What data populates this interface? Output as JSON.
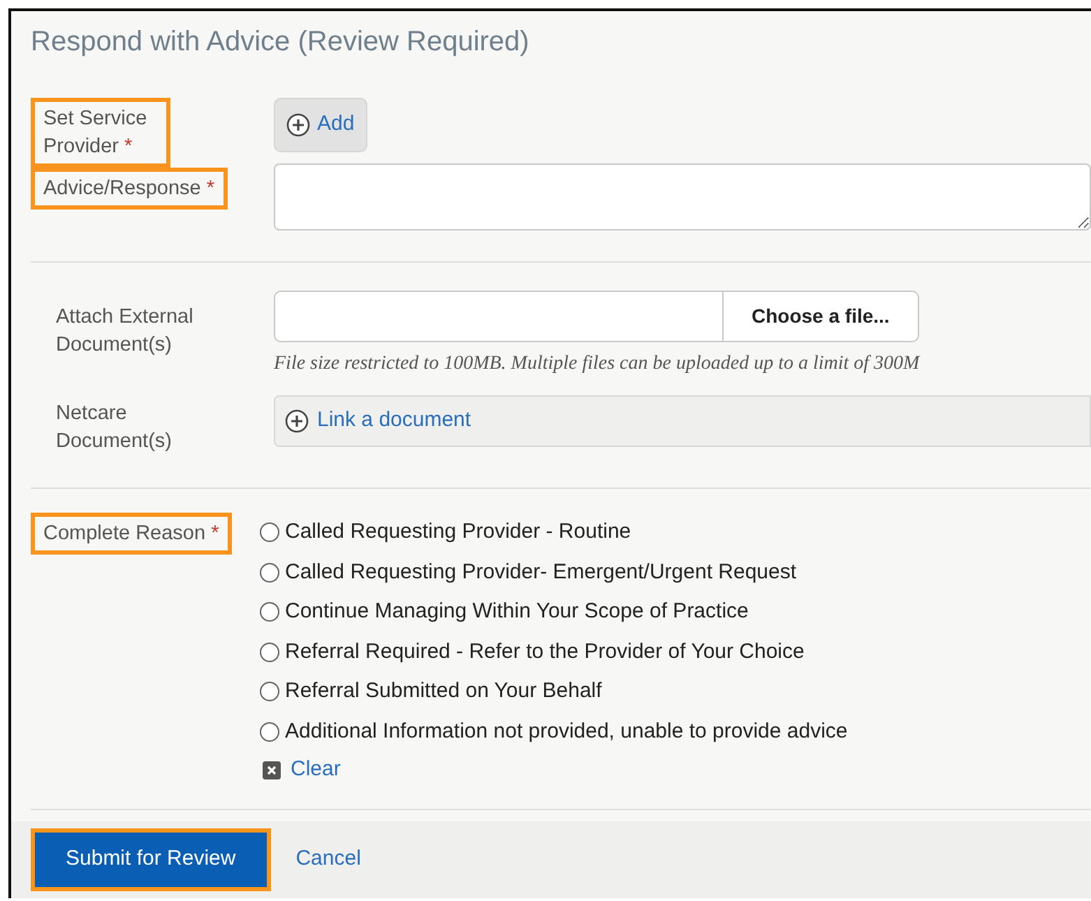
{
  "title": "Respond with Advice (Review Required)",
  "fields": [
    {
      "kind": "add",
      "label": "Set Service Provider",
      "required_mark": "*",
      "highlighted": true,
      "button": "Add"
    },
    {
      "kind": "textarea",
      "label": "Advice/Response",
      "required_mark": "*",
      "highlighted": true
    }
  ],
  "attachments": [
    {
      "kind": "file",
      "label": "Attach External Document(s)",
      "button": "Choose a file...",
      "note": "File size restricted to 100MB. Multiple files can be uploaded up to a limit of 300M"
    },
    {
      "kind": "link",
      "label": "Netcare Document(s)",
      "link": "Link a document"
    }
  ],
  "reason": {
    "label": "Complete Reason",
    "required_mark": "*",
    "highlighted": true,
    "options": [
      {
        "label": "Called Requesting Provider - Routine",
        "selected": false
      },
      {
        "label": "Called Requesting Provider- Emergent/Urgent Request",
        "selected": false
      },
      {
        "label": "Continue Managing Within Your Scope of Practice",
        "selected": false
      },
      {
        "label": "Referral Required - Refer to the Provider of Your Choice",
        "selected": false
      },
      {
        "label": "Referral Submitted on Your Behalf",
        "selected": false
      },
      {
        "label": "Additional Information not provided, unable to provide advice",
        "selected": false
      }
    ],
    "clear": "Clear"
  },
  "footer": {
    "submit": {
      "label": "Submit for Review",
      "highlighted": true
    },
    "cancel": "Cancel"
  }
}
